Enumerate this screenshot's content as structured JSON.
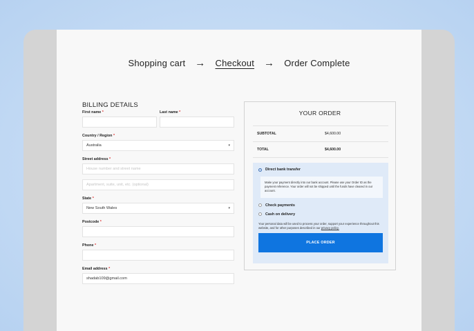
{
  "steps": {
    "cart": "Shopping cart",
    "arrow1": "→",
    "checkout": "Checkout",
    "arrow2": "→",
    "complete": "Order Complete"
  },
  "billing": {
    "title": "BILLING DETAILS",
    "first_name": {
      "label": "First name",
      "req": "*",
      "value": ""
    },
    "last_name": {
      "label": "Last name",
      "req": "*",
      "value": ""
    },
    "country": {
      "label": "Country / Region",
      "req": "*",
      "value": "Australia"
    },
    "street": {
      "label": "Street address",
      "req": "*",
      "placeholder1": "House number and street name",
      "placeholder2": "Apartment, suite, unit, etc. (optional)"
    },
    "state": {
      "label": "State",
      "req": "*",
      "value": "New South Wales"
    },
    "postcode": {
      "label": "Postcode",
      "req": "*",
      "value": ""
    },
    "phone": {
      "label": "Phone",
      "req": "*",
      "value": ""
    },
    "email": {
      "label": "Email address",
      "req": "*",
      "value": "shadab109@gmail.com"
    }
  },
  "order": {
    "title": "YOUR ORDER",
    "subtotal_label": "SUBTOTAL",
    "subtotal_value": "$4,600.00",
    "total_label": "TOTAL",
    "total_value": "$4,600.00",
    "payment": {
      "bank": "Direct bank transfer",
      "bank_desc": "Make your payment directly into our bank account. Please use your Order ID as the payment reference. Your order will not be shipped until the funds have cleared in our account.",
      "check": "Check payments",
      "cod": "Cash on delivery",
      "privacy_text": "Your personal data will be used to process your order, support your experience throughout this website, and for other purposes described in our",
      "privacy_link": "privacy policy.",
      "button": "PLACE ORDER"
    }
  },
  "colors": {
    "accent": "#0f75e0",
    "panel": "#dfeaf8",
    "background": "#c6dcf5"
  }
}
